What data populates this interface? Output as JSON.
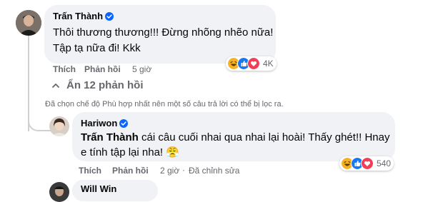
{
  "comments": [
    {
      "author": "Trấn Thành",
      "lines": [
        "Thôi thương thương!!! Đừng nhõng nhẽo nữa!",
        "Tập tạ nữa đi! Kkk"
      ],
      "actions": {
        "like": "Thích",
        "reply": "Phản hồi",
        "time": "5 giờ"
      },
      "reaction_count": "4K"
    },
    {
      "author": "Hariwon",
      "mention": "Trấn Thành",
      "lines": [
        " cái câu cuối nhai qua nhai lại hoài! Thấy ghét!! Hnay",
        "e tính tập lại nha! 😤"
      ],
      "actions": {
        "like": "Thích",
        "reply": "Phản hồi",
        "time": "2 giờ",
        "edited": "Đã chỉnh sửa"
      },
      "reaction_count": "540"
    }
  ],
  "hide_replies_label": "Ẩn 12 phản hồi",
  "filter_notice": "Đã chọn chế độ Phù hợp nhất nên một số câu trả lời có thể bị lọc ra.",
  "partial_author": "Will Win",
  "colors": {
    "bubble": "#f0f2f5",
    "secondary_text": "#65676b",
    "verified": "#0866ff",
    "like": "#1877f2",
    "love": "#f33e58",
    "haha": "#f7b125"
  },
  "reaction_icons": [
    "haha-icon",
    "like-icon",
    "love-icon"
  ]
}
